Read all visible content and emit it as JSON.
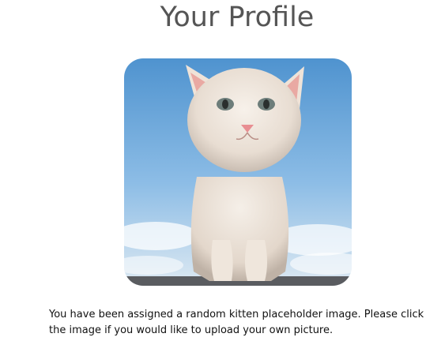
{
  "page": {
    "title": "Your Profile"
  },
  "profile_image": {
    "description_icon": "kitten-photo",
    "clickable": true
  },
  "info": {
    "message": "You have been assigned a random kitten placeholder image. Please click the image if you would like to upload your own picture."
  },
  "colors": {
    "title": "#555555",
    "text": "#111111",
    "sky_top": "#5e9fd6",
    "sky_bottom": "#cfe3f2",
    "fur": "#efe7df"
  }
}
